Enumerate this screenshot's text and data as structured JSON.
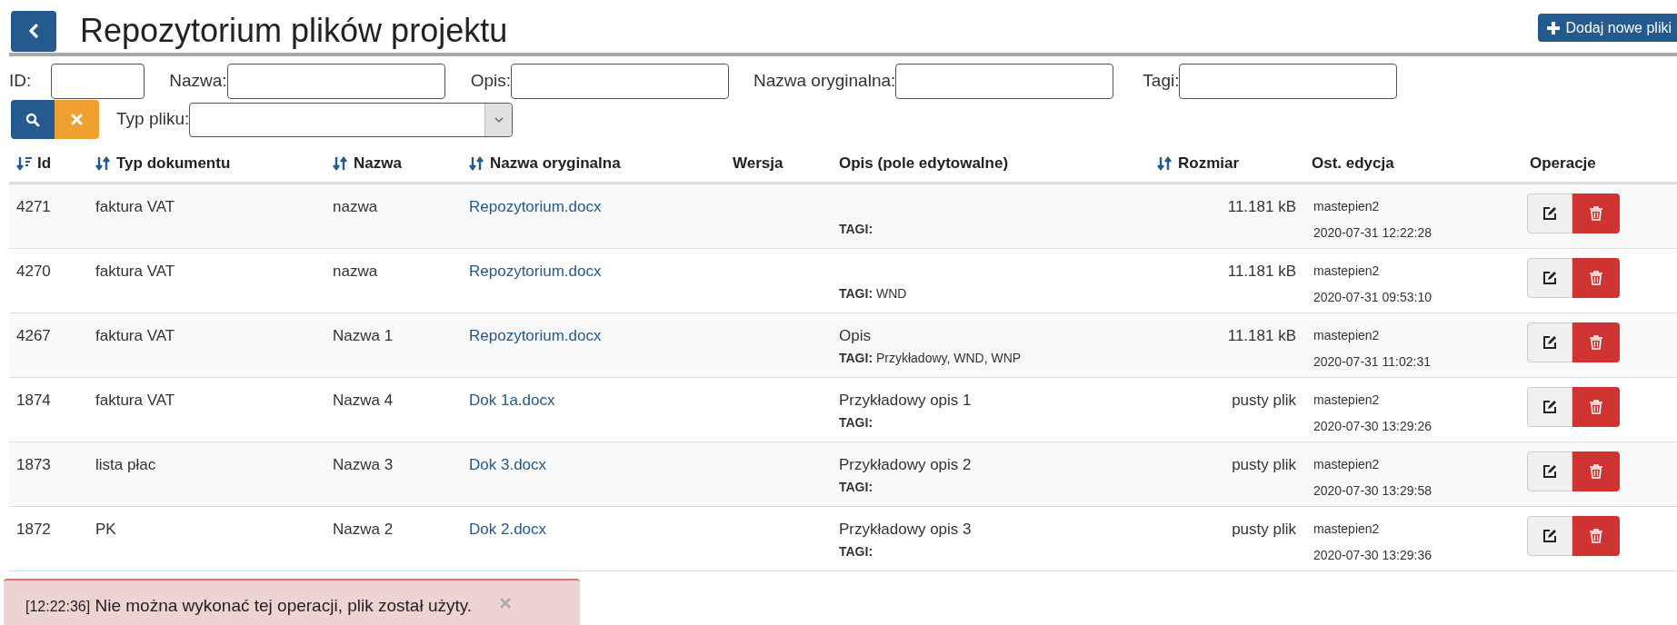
{
  "header": {
    "title": "Repozytorium plików projektu",
    "add_button": "Dodaj nowe pliki"
  },
  "filters": [
    {
      "label": "ID:",
      "kind": "short"
    },
    {
      "label": "Nazwa:",
      "kind": "long"
    },
    {
      "label": "Opis:",
      "kind": "long"
    },
    {
      "label": "Nazwa oryginalna:",
      "kind": "long"
    },
    {
      "label": "Tagi:",
      "kind": "long"
    }
  ],
  "type_filter": {
    "label": "Typ pliku:"
  },
  "table": {
    "columns": [
      {
        "label": "Id",
        "kind": "sorted"
      },
      {
        "label": "Typ dokumentu",
        "kind": "sortable"
      },
      {
        "label": "Nazwa",
        "kind": "sortable"
      },
      {
        "label": "Nazwa oryginalna",
        "kind": "sortable"
      },
      {
        "label": "Wersja",
        "kind": "plain"
      },
      {
        "label": "Opis (pole edytowalne)",
        "kind": "plain"
      },
      {
        "label": "Rozmiar",
        "kind": "sortable"
      },
      {
        "label": "Ost. edycja",
        "kind": "plain"
      },
      {
        "label": "Operacje",
        "kind": "plain"
      }
    ],
    "rows": [
      {
        "id": "4271",
        "type": "faktura VAT",
        "name": "nazwa",
        "original_name": "Repozytorium.docx",
        "tags_label": "TAGI:",
        "size": "11.181 kB",
        "user": "mastepien2",
        "date": "2020-07-31 12:22:28"
      },
      {
        "id": "4270",
        "type": "faktura VAT",
        "name": "nazwa",
        "original_name": "Repozytorium.docx",
        "tags_label": "TAGI:",
        "tags": "WND",
        "size": "11.181 kB",
        "user": "mastepien2",
        "date": "2020-07-31 09:53:10"
      },
      {
        "id": "4267",
        "type": "faktura VAT",
        "name": "Nazwa 1",
        "original_name": "Repozytorium.docx",
        "description": "Opis",
        "tags_label": "TAGI:",
        "tags": "Przykładowy, WND, WNP",
        "size": "11.181 kB",
        "user": "mastepien2",
        "date": "2020-07-31 11:02:31"
      },
      {
        "id": "1874",
        "type": "faktura VAT",
        "name": "Nazwa 4",
        "original_name": "Dok 1a.docx",
        "description": "Przykładowy opis 1",
        "tags_label": "TAGI:",
        "size": "pusty plik",
        "user": "mastepien2",
        "date": "2020-07-30 13:29:26"
      },
      {
        "id": "1873",
        "type": "lista płac",
        "name": "Nazwa 3",
        "original_name": "Dok 3.docx",
        "description": "Przykładowy opis 2",
        "tags_label": "TAGI:",
        "size": "pusty plik",
        "user": "mastepien2",
        "date": "2020-07-30 13:29:58"
      },
      {
        "id": "1872",
        "type": "PK",
        "name": "Nazwa 2",
        "original_name": "Dok 2.docx",
        "description": "Przykładowy opis 3",
        "tags_label": "TAGI:",
        "size": "pusty plik",
        "user": "mastepien2",
        "date": "2020-07-30 13:29:36"
      }
    ]
  },
  "alert": {
    "time": "[12:22:36]",
    "message": "Nie można wykonać tej operacji, plik został użyty.",
    "close": "×"
  }
}
